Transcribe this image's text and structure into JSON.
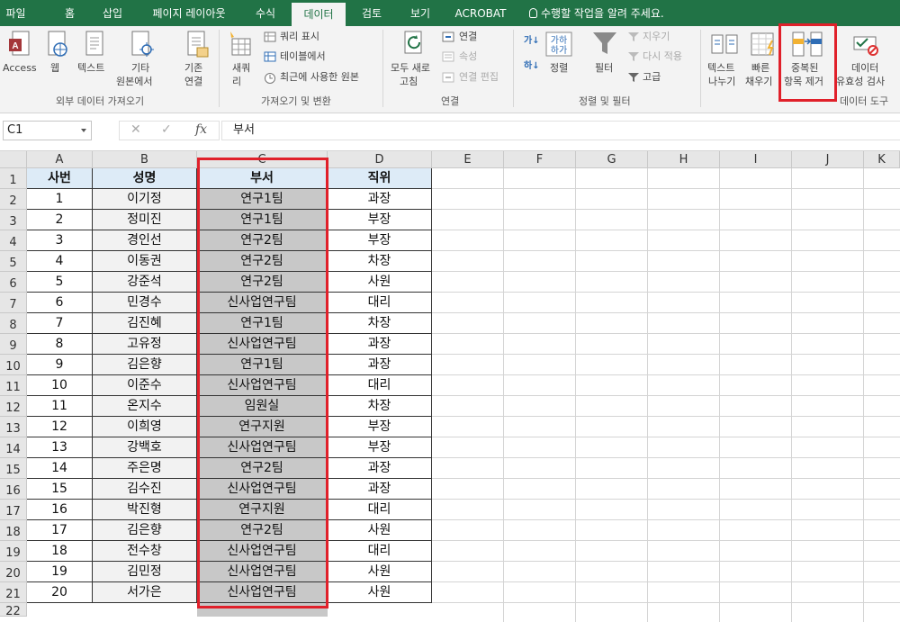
{
  "tabs": [
    "파일",
    "홈",
    "삽입",
    "페이지 레이아웃",
    "수식",
    "데이터",
    "검토",
    "보기",
    "ACROBAT"
  ],
  "active_tab": "데이터",
  "tell_me": "수행할 작업을 알려 주세요.",
  "ribbon": {
    "access": "Access",
    "web": "웹",
    "text": "텍스트",
    "other_sources_1": "기타",
    "other_sources_2": "원본에서",
    "existing_1": "기존",
    "existing_2": "연결",
    "external_group": "외부 데이터 가져오기",
    "new_query_1": "새쿼",
    "new_query_2": "리",
    "show_queries": "쿼리 표시",
    "from_table": "테이블에서",
    "recent_sources": "최근에 사용한 원본",
    "get_transform_group": "가져오기 및 변환",
    "refresh_all_1": "모두 새로",
    "refresh_all_2": "고침",
    "connections": "연결",
    "properties": "속성",
    "edit_links": "연결 편집",
    "connections_group": "연결",
    "sort": "정렬",
    "filter": "필터",
    "clear": "지우기",
    "reapply": "다시 적용",
    "advanced": "고급",
    "sort_filter_group": "정렬 및 필터",
    "text_to_columns_1": "텍스트",
    "text_to_columns_2": "나누기",
    "flash_fill_1": "빠른",
    "flash_fill_2": "채우기",
    "remove_duplicates_1": "중복된",
    "remove_duplicates_2": "항목 제거",
    "validation_1": "데이터",
    "validation_2": "유효성 검사",
    "data_tools_group": "데이터 도구"
  },
  "formula_bar": {
    "name_box": "C1",
    "formula": "부서"
  },
  "columns": [
    "A",
    "B",
    "C",
    "D",
    "E",
    "F",
    "G",
    "H",
    "I",
    "J",
    "K"
  ],
  "rows": [
    "1",
    "2",
    "3",
    "4",
    "5",
    "6",
    "7",
    "8",
    "9",
    "10",
    "11",
    "12",
    "13",
    "14",
    "15",
    "16",
    "17",
    "18",
    "19",
    "20",
    "21",
    "22"
  ],
  "table": {
    "headers": [
      "사번",
      "성명",
      "부서",
      "직위"
    ],
    "data": [
      [
        "1",
        "이기정",
        "연구1팀",
        "과장"
      ],
      [
        "2",
        "정미진",
        "연구1팀",
        "부장"
      ],
      [
        "3",
        "경인선",
        "연구2팀",
        "부장"
      ],
      [
        "4",
        "이동권",
        "연구2팀",
        "차장"
      ],
      [
        "5",
        "강준석",
        "연구2팀",
        "사원"
      ],
      [
        "6",
        "민경수",
        "신사업연구팀",
        "대리"
      ],
      [
        "7",
        "김진혜",
        "연구1팀",
        "차장"
      ],
      [
        "8",
        "고유정",
        "신사업연구팀",
        "과장"
      ],
      [
        "9",
        "김은향",
        "연구1팀",
        "과장"
      ],
      [
        "10",
        "이준수",
        "신사업연구팀",
        "대리"
      ],
      [
        "11",
        "온지수",
        "임원실",
        "차장"
      ],
      [
        "12",
        "이희영",
        "연구지원",
        "부장"
      ],
      [
        "13",
        "강백호",
        "신사업연구팀",
        "부장"
      ],
      [
        "14",
        "주은명",
        "연구2팀",
        "과장"
      ],
      [
        "15",
        "김수진",
        "신사업연구팀",
        "과장"
      ],
      [
        "16",
        "박진형",
        "연구지원",
        "대리"
      ],
      [
        "17",
        "김은향",
        "연구2팀",
        "사원"
      ],
      [
        "18",
        "전수창",
        "신사업연구팀",
        "대리"
      ],
      [
        "19",
        "김민정",
        "신사업연구팀",
        "사원"
      ],
      [
        "20",
        "서가은",
        "신사업연구팀",
        "사원"
      ]
    ]
  },
  "colors": {
    "accent": "#217346",
    "highlight": "#e0202a",
    "header_fill": "#ddebf7",
    "selected_fill": "#c8c8c8"
  }
}
